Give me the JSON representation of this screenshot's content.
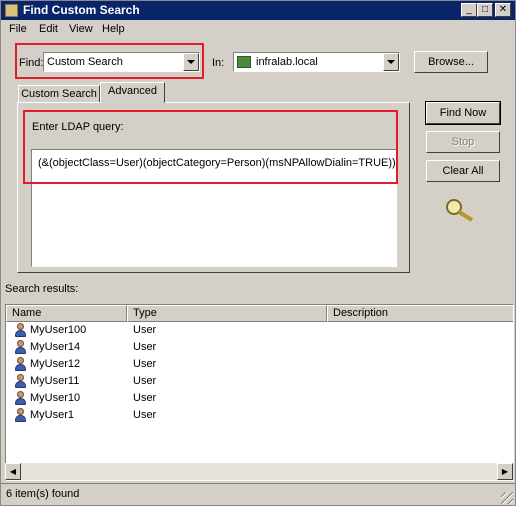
{
  "window": {
    "title": "Find Custom Search"
  },
  "menu": {
    "file": "File",
    "edit": "Edit",
    "view": "View",
    "help": "Help"
  },
  "find": {
    "label": "Find:",
    "value": "Custom Search"
  },
  "in": {
    "label": "In:",
    "value": "infralab.local"
  },
  "buttons": {
    "browse": "Browse...",
    "find_now": "Find Now",
    "stop": "Stop",
    "clear_all": "Clear All"
  },
  "tabs": {
    "custom_search": "Custom Search",
    "advanced": "Advanced"
  },
  "ldap": {
    "label": "Enter LDAP query:",
    "query": "(&(objectClass=User)(objectCategory=Person)(msNPAllowDialin=TRUE))"
  },
  "results": {
    "label": "Search results:",
    "columns": {
      "name": "Name",
      "type": "Type",
      "description": "Description"
    },
    "rows": [
      {
        "name": "MyUser100",
        "type": "User"
      },
      {
        "name": "MyUser14",
        "type": "User"
      },
      {
        "name": "MyUser12",
        "type": "User"
      },
      {
        "name": "MyUser11",
        "type": "User"
      },
      {
        "name": "MyUser10",
        "type": "User"
      },
      {
        "name": "MyUser1",
        "type": "User"
      }
    ]
  },
  "status": "6 item(s) found",
  "colors": {
    "annotation_red": "#e11d2a",
    "titlebar": "#0a246a",
    "dialog_face": "#d4d0c8"
  }
}
